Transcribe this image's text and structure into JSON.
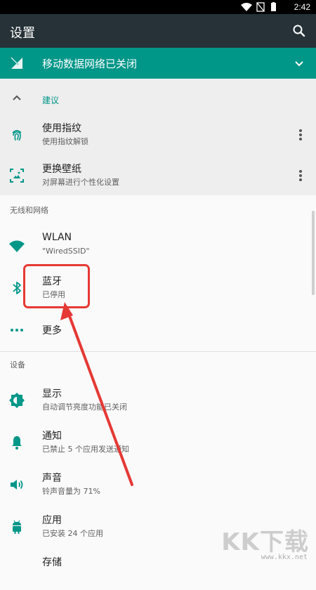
{
  "status_bar": {
    "time": "2:42"
  },
  "app_bar": {
    "title": "设置"
  },
  "banner": {
    "label": "移动数据网络已关闭",
    "bg_color": "#009688"
  },
  "suggestions": {
    "header": "建议",
    "items": [
      {
        "title": "使用指纹",
        "subtitle": "使用指纹解锁"
      },
      {
        "title": "更换壁纸",
        "subtitle": "对屏幕进行个性化设置"
      }
    ]
  },
  "sections": [
    {
      "header": "无线和网络",
      "items": [
        {
          "title": "WLAN",
          "subtitle": "\"WiredSSID\""
        },
        {
          "title": "蓝牙",
          "subtitle": "已停用"
        },
        {
          "title": "更多",
          "subtitle": ""
        }
      ]
    },
    {
      "header": "设备",
      "items": [
        {
          "title": "显示",
          "subtitle": "自动调节亮度功能已关闭"
        },
        {
          "title": "通知",
          "subtitle": "已禁止 5 个应用发送通知"
        },
        {
          "title": "声音",
          "subtitle": "铃声音量为 71%"
        },
        {
          "title": "应用",
          "subtitle": "已安装 24 个应用"
        },
        {
          "title": "存储",
          "subtitle": ""
        }
      ]
    }
  ],
  "watermark": {
    "logo": "KK下载",
    "url": "www.kkx.net"
  },
  "colors": {
    "accent": "#009688",
    "annotation": "#e53935"
  }
}
